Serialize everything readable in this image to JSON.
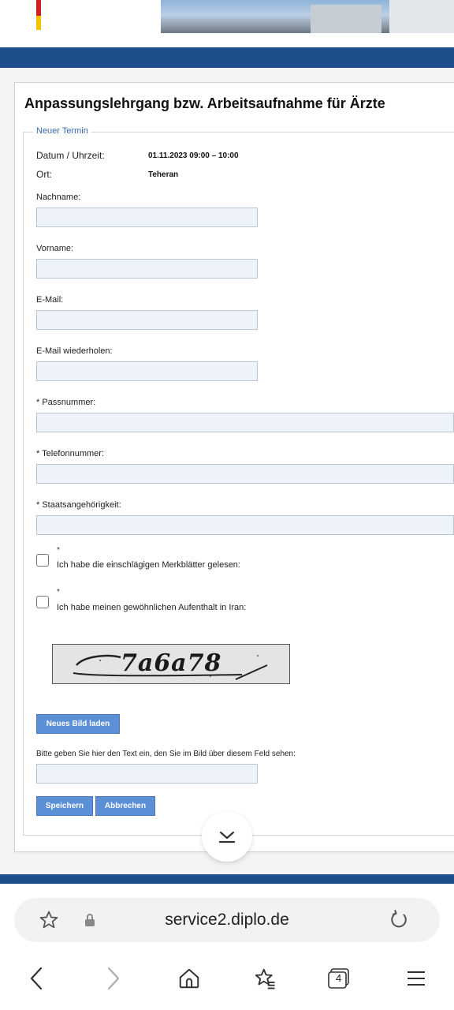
{
  "header": {
    "colors": {
      "nav_band": "#1f4e8c",
      "flag_red": "#d21e1e",
      "flag_gold": "#f4c400"
    }
  },
  "form": {
    "title": "Anpassungslehrgang bzw. Arbeitsaufnahme für Ärzte",
    "legend": "Neuer Termin",
    "info": {
      "date_label": "Datum / Uhrzeit:",
      "date_value": "01.11.2023 09:00 – 10:00",
      "place_label": "Ort:",
      "place_value": "Teheran"
    },
    "fields": {
      "nachname": {
        "label": "Nachname:",
        "value": ""
      },
      "vorname": {
        "label": "Vorname:",
        "value": ""
      },
      "email": {
        "label": "E-Mail:",
        "value": ""
      },
      "email_repeat": {
        "label": "E-Mail wiederholen:",
        "value": ""
      },
      "passnummer": {
        "label": "* Passnummer:",
        "value": ""
      },
      "telefon": {
        "label": "* Telefonnummer:",
        "value": ""
      },
      "staat": {
        "label": "* Staatsangehörigkeit:",
        "value": ""
      }
    },
    "checkboxes": {
      "merkblatt": {
        "star": "*",
        "label": "Ich habe die einschlägigen Merkblätter gelesen:",
        "checked": false
      },
      "aufenthalt": {
        "star": "*",
        "label": "Ich habe meinen gewöhnlichen Aufenthalt in Iran:",
        "checked": false
      }
    },
    "captcha": {
      "image_text": "7a6a78",
      "reload_button": "Neues Bild laden",
      "instruction": "Bitte geben Sie hier den Text ein, den Sie im Bild über diesem Feld sehen:",
      "value": ""
    },
    "buttons": {
      "save": "Speichern",
      "cancel": "Abbrechen"
    },
    "colors": {
      "button_bg": "#5b8fd6",
      "input_bg": "#eef2f9",
      "legend": "#3a6aa8"
    }
  },
  "browser": {
    "url": "service2.diplo.de",
    "tab_count": "4",
    "icons": [
      "star-icon",
      "lock-icon",
      "reload-icon",
      "back-icon",
      "forward-icon",
      "home-icon",
      "bookmarks-icon",
      "tabs-icon",
      "menu-icon"
    ]
  }
}
